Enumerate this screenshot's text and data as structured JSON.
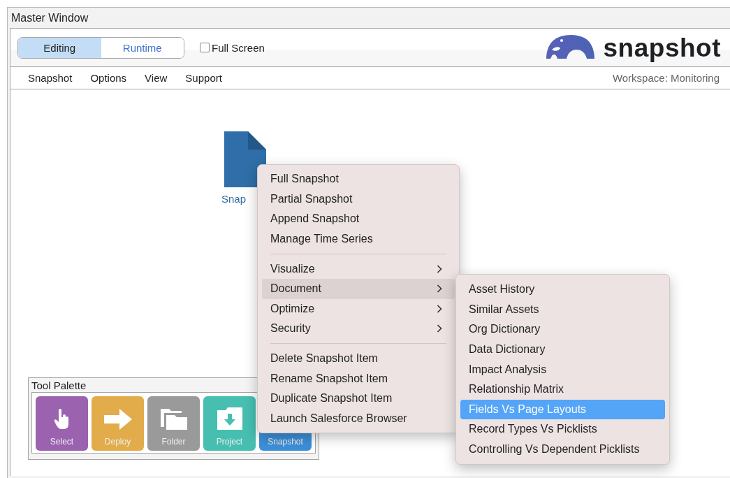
{
  "window": {
    "title": "Master Window"
  },
  "mode_tabs": [
    {
      "label": "Editing",
      "selected": true
    },
    {
      "label": "Runtime",
      "selected": false
    }
  ],
  "full_screen": {
    "label": "Full Screen",
    "checked": false
  },
  "logo": {
    "text": "snapshot"
  },
  "menu_bar": [
    "Snapshot",
    "Options",
    "View",
    "Support"
  ],
  "workspace": "Workspace: Monitoring",
  "canvas_item": {
    "label": "Snap"
  },
  "tool_palette": {
    "title": "Tool Palette",
    "tools": [
      {
        "label": "Select",
        "kind": "hand",
        "color": "#9b62b0"
      },
      {
        "label": "Deploy",
        "kind": "arrow",
        "color": "#e2ac4b"
      },
      {
        "label": "Folder",
        "kind": "folder",
        "color": "#9a9a9a"
      },
      {
        "label": "Project",
        "kind": "download",
        "color": "#46bfb1"
      },
      {
        "label": "Snapshot",
        "kind": "hidden",
        "color": "#3d8fd9"
      }
    ]
  },
  "context_menu": [
    {
      "kind": "item",
      "label": "Full Snapshot",
      "submenu": false,
      "selected": false
    },
    {
      "kind": "item",
      "label": "Partial Snapshot",
      "submenu": false,
      "selected": false
    },
    {
      "kind": "item",
      "label": "Append Snapshot",
      "submenu": false,
      "selected": false
    },
    {
      "kind": "item",
      "label": "Manage Time Series",
      "submenu": false,
      "selected": false
    },
    {
      "kind": "separator"
    },
    {
      "kind": "item",
      "label": "Visualize",
      "submenu": true,
      "selected": false
    },
    {
      "kind": "item",
      "label": "Document",
      "submenu": true,
      "selected": true
    },
    {
      "kind": "item",
      "label": "Optimize",
      "submenu": true,
      "selected": false
    },
    {
      "kind": "item",
      "label": "Security",
      "submenu": true,
      "selected": false
    },
    {
      "kind": "separator"
    },
    {
      "kind": "item",
      "label": "Delete Snapshot Item",
      "submenu": false,
      "selected": false
    },
    {
      "kind": "item",
      "label": "Rename Snapshot Item",
      "submenu": false,
      "selected": false
    },
    {
      "kind": "item",
      "label": "Duplicate Snapshot Item",
      "submenu": false,
      "selected": false
    },
    {
      "kind": "item",
      "label": "Launch Salesforce Browser",
      "submenu": false,
      "selected": false
    }
  ],
  "submenu": [
    {
      "label": "Asset History",
      "selected": false
    },
    {
      "label": "Similar Assets",
      "selected": false
    },
    {
      "label": "Org Dictionary",
      "selected": false
    },
    {
      "label": "Data Dictionary",
      "selected": false
    },
    {
      "label": "Impact Analysis",
      "selected": false
    },
    {
      "label": "Relationship Matrix",
      "selected": false
    },
    {
      "label": "Fields Vs Page Layouts",
      "selected": true
    },
    {
      "label": "Record Types Vs Picklists",
      "selected": false
    },
    {
      "label": "Controlling Vs Dependent Picklists",
      "selected": false
    }
  ]
}
